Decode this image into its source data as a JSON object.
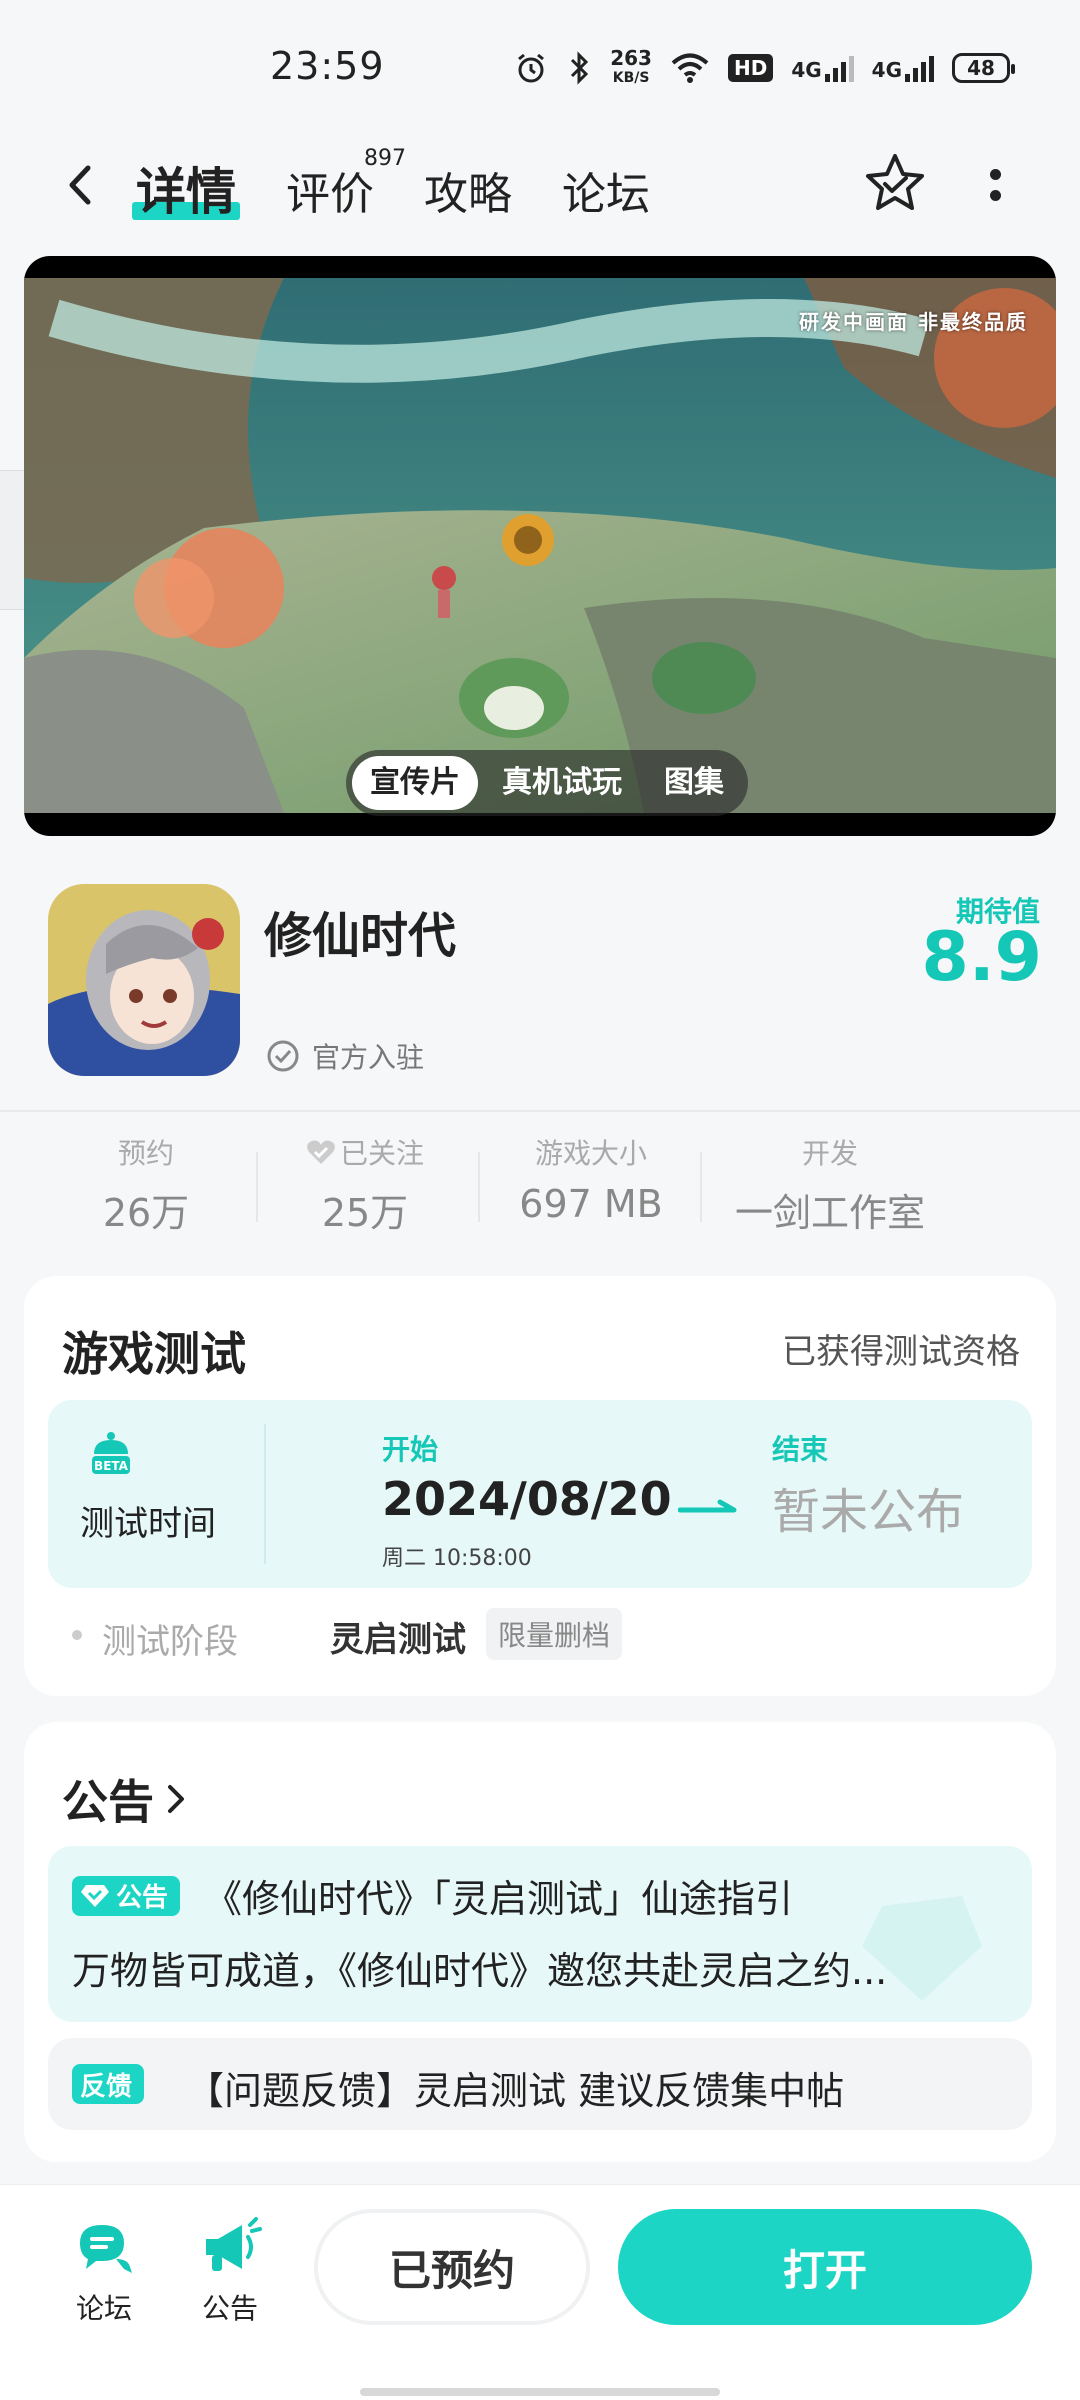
{
  "status_bar": {
    "time": "23:59",
    "net_speed_value": "263",
    "net_speed_unit": "KB/S",
    "hd": "HD",
    "signal1": "4G",
    "signal2": "4G",
    "battery": "48"
  },
  "nav": {
    "tabs": [
      {
        "label": "详情",
        "active": true
      },
      {
        "label": "评价",
        "badge": "897"
      },
      {
        "label": "攻略"
      },
      {
        "label": "论坛"
      }
    ]
  },
  "media": {
    "watermark": "研发中画面 非最终品质",
    "tabs": [
      "宣传片",
      "真机试玩",
      "图集"
    ],
    "active_tab": "宣传片"
  },
  "game": {
    "name": "修仙时代",
    "official_label": "官方入驻",
    "expect_label": "期待值",
    "expect_value": "8.9"
  },
  "stats": [
    {
      "label": "预约",
      "value": "26万"
    },
    {
      "label": "已关注",
      "value": "25万"
    },
    {
      "label": "游戏大小",
      "value": "697 MB"
    },
    {
      "label": "开发",
      "value": "一剑工作室"
    }
  ],
  "test": {
    "title": "游戏测试",
    "qualification": "已获得测试资格",
    "beta_icon_text": "BETA",
    "time_label": "测试时间",
    "start_label": "开始",
    "start_date": "2024/08/20",
    "start_sub": "周二  10:58:00",
    "end_label": "结束",
    "end_value": "暂未公布",
    "phase_label": "测试阶段",
    "phase_value": "灵启测试",
    "phase_tag": "限量删档"
  },
  "notice": {
    "title": "公告",
    "item1_tag": "公告",
    "item1_line1": "《修仙时代》「灵启测试」仙途指引",
    "item1_line2": "万物皆可成道，《修仙时代》邀您共赴灵启之约...",
    "item2_tag": "反馈",
    "item2_text": "【问题反馈】灵启测试 建议反馈集中帖"
  },
  "bottom_bar": {
    "forum_label": "论坛",
    "notice_label": "公告",
    "reserved_label": "已预约",
    "open_label": "打开"
  },
  "colors": {
    "accent": "#1dd5c4",
    "accent_text": "#14c7b6",
    "panel_bg": "#e6f8f7",
    "page_bg": "#f5f7f8"
  }
}
